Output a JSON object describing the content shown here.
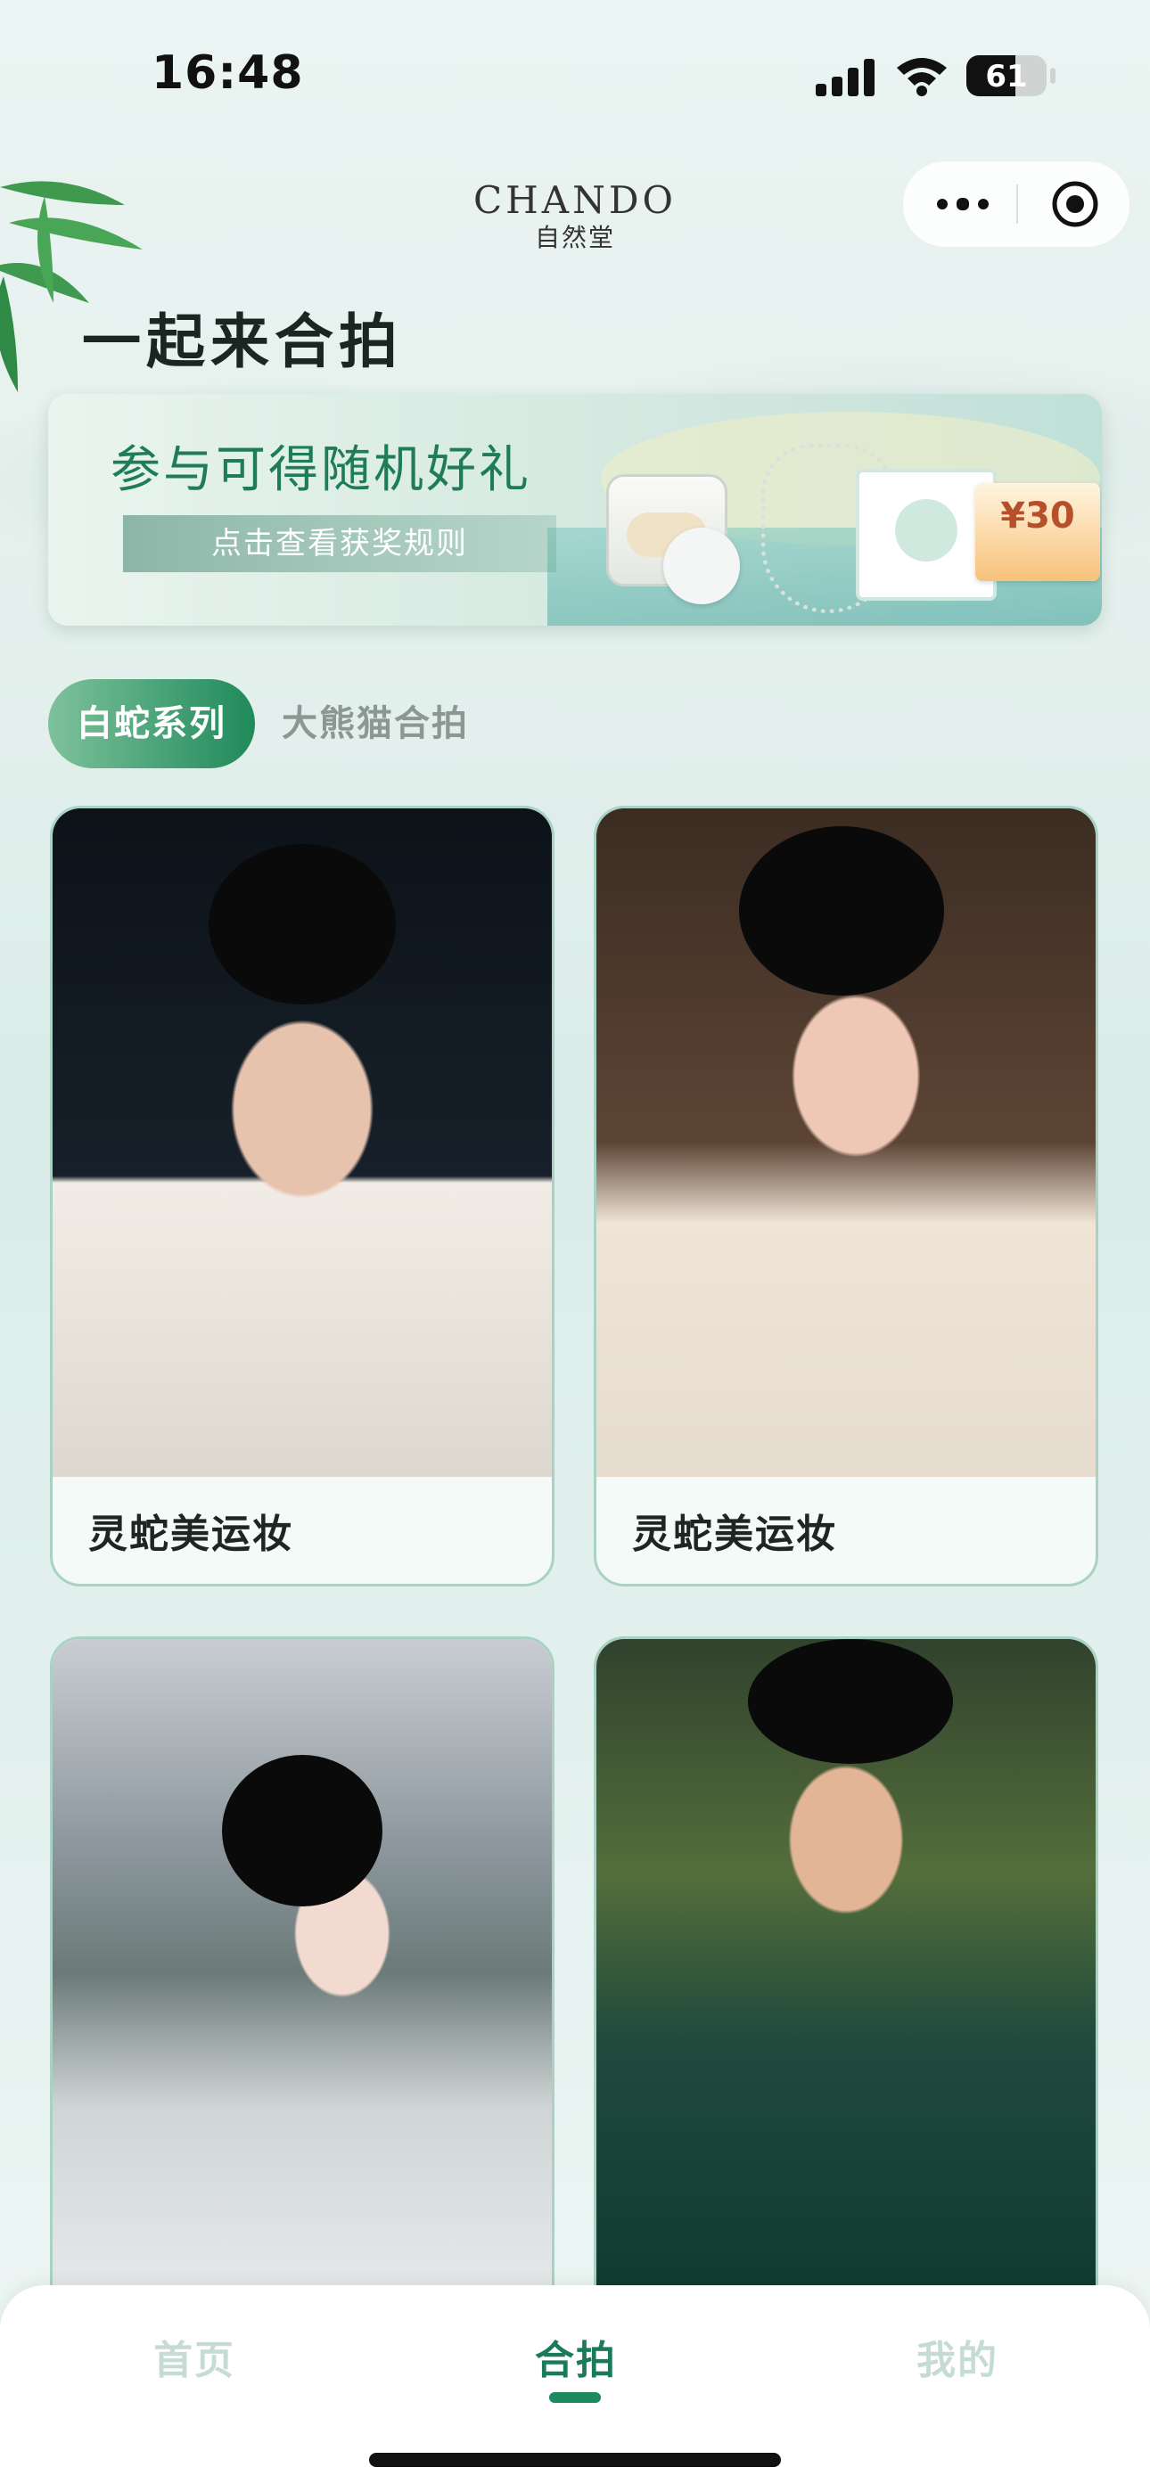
{
  "status_bar": {
    "time": "16:48",
    "battery": "61"
  },
  "header": {
    "brand_en": "CHANDO",
    "brand_zh": "自然堂"
  },
  "page_title": "一起来合拍",
  "banner": {
    "headline": "参与可得随机好礼",
    "link_text": "点击查看获奖规则",
    "coupon_amount": "¥30"
  },
  "tabs": [
    {
      "label": "白蛇系列",
      "active": true
    },
    {
      "label": "大熊猫合拍",
      "active": false
    }
  ],
  "cards": [
    {
      "caption": "灵蛇美运妆"
    },
    {
      "caption": "灵蛇美运妆"
    },
    {
      "caption": ""
    },
    {
      "caption": ""
    }
  ],
  "bottom_nav": [
    {
      "label": "首页",
      "active": false
    },
    {
      "label": "合拍",
      "active": true
    },
    {
      "label": "我的",
      "active": false
    }
  ],
  "colors": {
    "accent": "#1d8a5e",
    "card_border": "#a9d2c4",
    "headline": "#1e7d55"
  }
}
